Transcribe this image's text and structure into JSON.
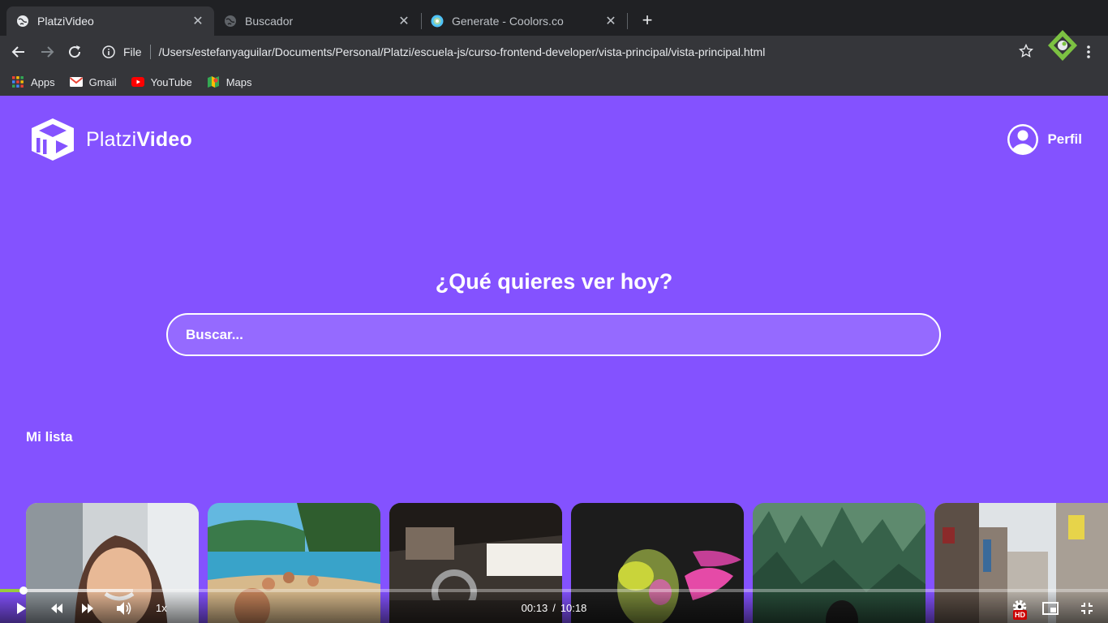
{
  "browser": {
    "tabs": [
      {
        "title": "PlatziVideo",
        "active": true
      },
      {
        "title": "Buscador",
        "active": false
      },
      {
        "title": "Generate - Coolors.co",
        "active": false
      }
    ],
    "omnibox": {
      "scheme": "File",
      "url": "/Users/estefanyaguilar/Documents/Personal/Platzi/escuela-js/curso-frontend-developer/vista-principal/vista-principal.html"
    },
    "bookmarks": [
      {
        "label": "Apps",
        "icon": "apps-grid-icon"
      },
      {
        "label": "Gmail",
        "icon": "gmail-icon"
      },
      {
        "label": "YouTube",
        "icon": "youtube-icon"
      },
      {
        "label": "Maps",
        "icon": "maps-icon"
      }
    ]
  },
  "page": {
    "logo": {
      "light": "Platzi",
      "bold": "Video"
    },
    "profile_label": "Perfil",
    "hero_title": "¿Qué quieres ver hoy?",
    "search_placeholder": "Buscar...",
    "section_title": "Mi lista",
    "thumbnails": [
      {
        "subject": "woman-smiling-thumbnail"
      },
      {
        "subject": "beach-friends-thumbnail"
      },
      {
        "subject": "building-interior-thumbnail"
      },
      {
        "subject": "man-colored-powder-thumbnail"
      },
      {
        "subject": "forest-thumbnail"
      },
      {
        "subject": "city-street-thumbnail"
      }
    ],
    "colors": {
      "background": "#8452ff",
      "text": "#ffffff"
    }
  },
  "player": {
    "speed": "1x",
    "current_time": "00:13",
    "separator": "/",
    "duration": "10:18",
    "progress_fraction": 0.021,
    "buffer_fraction": 0.12,
    "hd_badge": "HD",
    "accent_color": "#98ca3f"
  }
}
